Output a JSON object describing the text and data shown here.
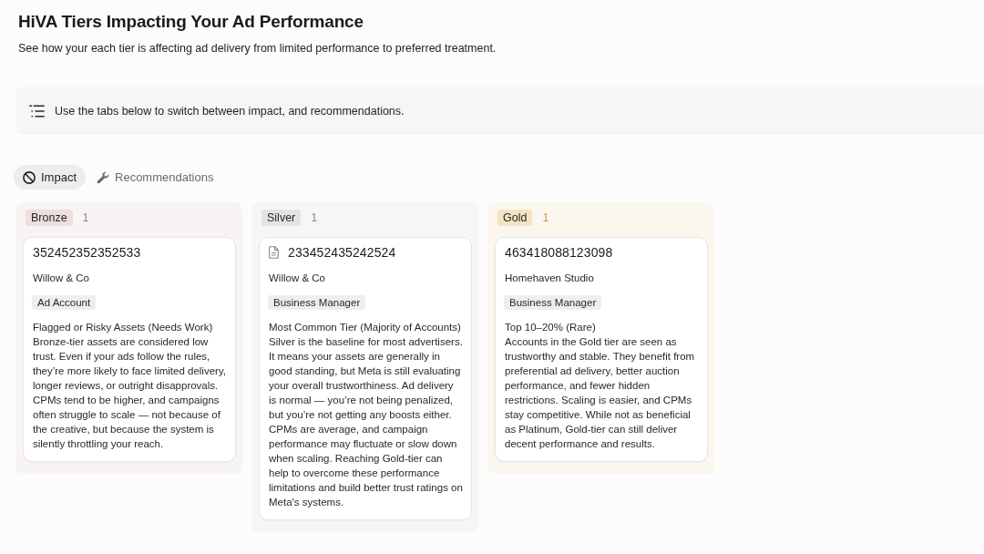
{
  "header": {
    "title": "HiVA Tiers Impacting Your Ad Performance",
    "subtitle": "See how your each tier is affecting ad delivery from limited performance to preferred treatment."
  },
  "callout": {
    "text": "Use the tabs below to switch between impact, and recommendations."
  },
  "tabs": [
    {
      "label": "Impact",
      "selected": true
    },
    {
      "label": "Recommendations",
      "selected": false
    }
  ],
  "columns": [
    {
      "tier": "Bronze",
      "color": "#ecdfdc",
      "count": {
        "text": "1",
        "color": "#8e8886"
      },
      "cards": [
        {
          "id": "352452352352533",
          "icon": false,
          "name": "Willow & Co",
          "type": "Ad Account",
          "heading": "Flagged or Risky Assets (Needs Work)",
          "body": "Bronze-tier assets are considered low trust. Even if your ads follow the rules, they’re more likely to face limited delivery, longer reviews, or outright disapprovals. CPMs tend to be higher, and campaigns often struggle to scale — not because of the creative, but because the system is silently throttling your reach."
        }
      ]
    },
    {
      "tier": "Silver",
      "color": "#e6e3e3",
      "count": {
        "text": "1",
        "color": "#8e8886"
      },
      "cards": [
        {
          "id": "233452435242524",
          "icon": true,
          "name": "Willow & Co",
          "type": "Business Manager",
          "heading": "Most Common Tier (Majority of Accounts)",
          "body": "Silver is the baseline for most advertisers. It means your assets are generally in good standing, but Meta is still evaluating your overall trustworthiness. Ad delivery is normal — you’re not being penalized, but you’re not getting any boosts either. CPMs are average, and campaign performance may fluctuate or slow down when scaling. Reaching Gold-tier can help to overcome these performance limitations and build better trust ratings on Meta's systems."
        }
      ]
    },
    {
      "tier": "Gold",
      "color": "#f4e4c2",
      "count": {
        "text": "1",
        "color": "#c49a3c"
      },
      "cards": [
        {
          "id": "463418088123098",
          "icon": false,
          "name": "Homehaven Studio",
          "type": "Business Manager",
          "heading": "Top 10–20% (Rare)",
          "body": "Accounts in the Gold tier are seen as trustworthy and stable. They benefit from preferential ad delivery, better auction performance, and fewer hidden restrictions. Scaling is easier, and CPMs stay competitive. While not as beneficial as Platinum, Gold-tier can still deliver decent performance and results."
        }
      ]
    }
  ]
}
